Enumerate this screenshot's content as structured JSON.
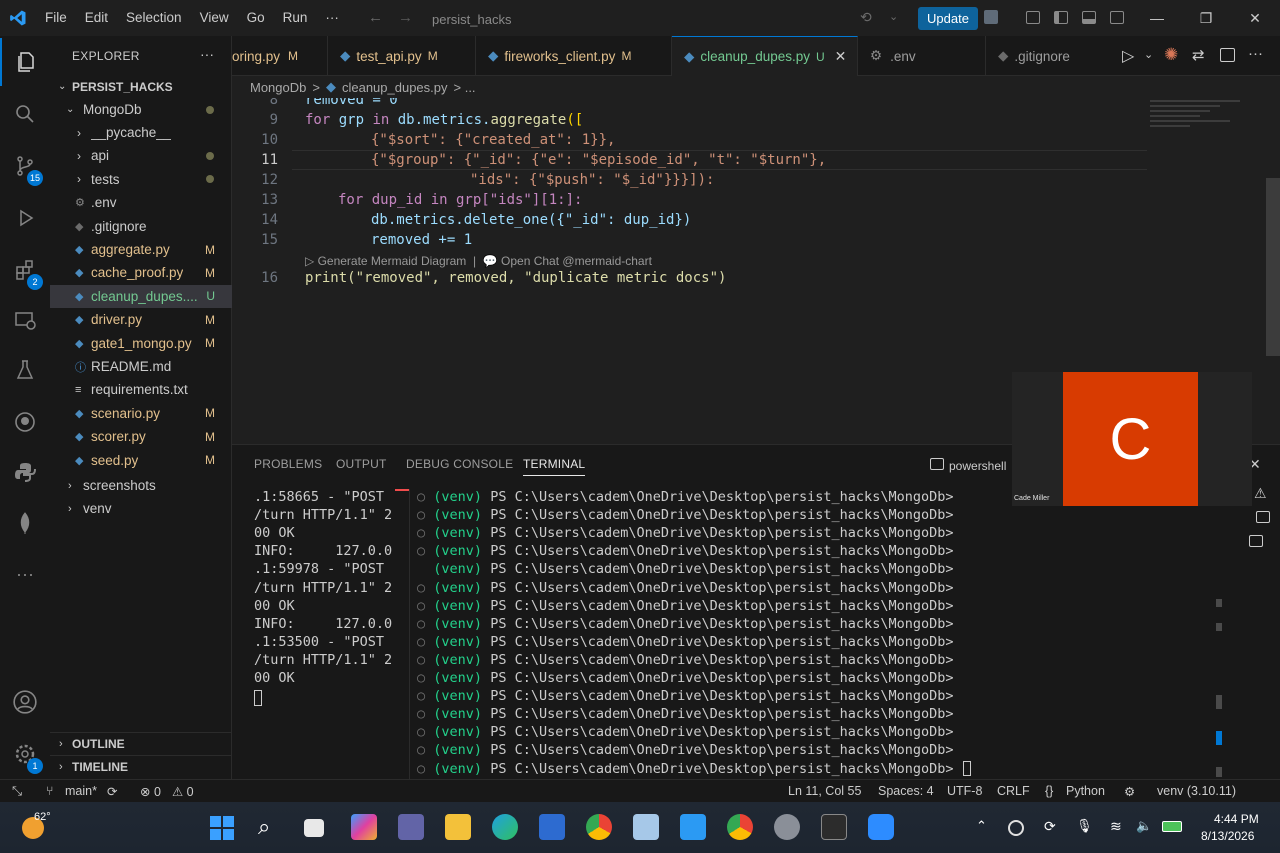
{
  "titlebar": {
    "menu": [
      "File",
      "Edit",
      "Selection",
      "View",
      "Go",
      "Run",
      "···"
    ],
    "search": "persist_hacks",
    "update_label": "Update",
    "icons": [
      "vscode-logo-icon",
      "back-arrow-icon",
      "forward-arrow-icon",
      "copilot-icon",
      "layout-icons",
      "minimize-icon",
      "restore-icon",
      "close-icon"
    ]
  },
  "activitybar": {
    "icons": [
      "explorer-icon",
      "search-icon",
      "source-control-icon",
      "run-debug-icon",
      "extensions-icon",
      "remote-explorer-icon",
      "testing-icon",
      "github-icon",
      "python-icon",
      "mongodb-icon",
      "more-icon",
      "account-icon",
      "manage-icon"
    ],
    "source_control_badge": "15",
    "extensions_badge": "2",
    "manage_badge": "1"
  },
  "sidebar": {
    "title": "EXPLORER",
    "more": "···",
    "root": "PERSIST_HACKS",
    "folder": "MongoDb",
    "items": [
      {
        "label": "__pycache__",
        "kind": "folder",
        "status": ""
      },
      {
        "label": "api",
        "kind": "folder",
        "status": "dot"
      },
      {
        "label": "tests",
        "kind": "folder",
        "status": "dot"
      },
      {
        "label": ".env",
        "kind": "gear",
        "status": ""
      },
      {
        "label": ".gitignore",
        "kind": "git",
        "status": ""
      },
      {
        "label": "aggregate.py",
        "kind": "py",
        "status": "M"
      },
      {
        "label": "cache_proof.py",
        "kind": "py",
        "status": "M"
      },
      {
        "label": "cleanup_dupes....",
        "kind": "py",
        "status": "U"
      },
      {
        "label": "driver.py",
        "kind": "py",
        "status": "M"
      },
      {
        "label": "gate1_mongo.py",
        "kind": "py",
        "status": "M"
      },
      {
        "label": "README.md",
        "kind": "info",
        "status": ""
      },
      {
        "label": "requirements.txt",
        "kind": "txt",
        "status": ""
      },
      {
        "label": "scenario.py",
        "kind": "py",
        "status": "M"
      },
      {
        "label": "scorer.py",
        "kind": "py",
        "status": "M"
      },
      {
        "label": "seed.py",
        "kind": "py",
        "status": "M"
      }
    ],
    "outer": [
      "screenshots",
      "venv"
    ],
    "outline": "OUTLINE",
    "timeline": "TIMELINE"
  },
  "tabs": [
    {
      "label": "oring.py",
      "status": "M"
    },
    {
      "label": "test_api.py",
      "status": "M"
    },
    {
      "label": "fireworks_client.py",
      "status": "M"
    },
    {
      "label": "cleanup_dupes.py",
      "status": "U"
    },
    {
      "label": ".env",
      "status": ""
    },
    {
      "label": ".gitignore",
      "status": ""
    }
  ],
  "breadcrumb": {
    "folder": "MongoDb",
    "sep": ">",
    "file": "cleanup_dupes.py",
    "tail": "> ..."
  },
  "editor": {
    "line_numbers": [
      "8",
      "9",
      "10",
      "11",
      "12",
      "13",
      "14",
      "15",
      "16"
    ],
    "lens": "▷ Generate Mermaid Diagram  |  💬 Open Chat @mermaid-chart",
    "lines": {
      "l8": "removed = 0",
      "l9a": "for",
      "l9b": " grp ",
      "l9c": "in",
      "l9d": " db.metrics.",
      "l9e": "aggregate",
      "l9f": "([",
      "l10": "{\"$sort\": {\"created_at\": 1}},",
      "l11": "{\"$group\": {\"_id\": {\"e\": \"$episode_id\", \"t\": \"$turn\"},",
      "l12": "\"ids\": {\"$push\": \"$_id\"}}}]):",
      "l13": "for dup_id in grp[\"ids\"][1:]:",
      "l14": "db.metrics.delete_one({\"_id\": dup_id})",
      "l15": "removed += 1",
      "l16": "print(\"removed\", removed, \"duplicate metric docs\")"
    }
  },
  "panel": {
    "tabs": [
      "PROBLEMS",
      "OUTPUT",
      "DEBUG CONSOLE",
      "TERMINAL"
    ],
    "shell": "powershell",
    "left_terminal": [
      ".1:58665 - \"POST",
      "/turn HTTP/1.1\" 2",
      "00 OK",
      "INFO:     127.0.0",
      ".1:59978 - \"POST",
      "/turn HTTP/1.1\" 2",
      "00 OK",
      "INFO:     127.0.0",
      ".1:53500 - \"POST",
      "/turn HTTP/1.1\" 2",
      "00 OK"
    ],
    "prompt_venv": "(venv)",
    "prompt_path": "PS C:\\Users\\cadem\\OneDrive\\Desktop\\persist_hacks\\MongoDb>",
    "prompt_count": 16
  },
  "zoom": {
    "initial": "C",
    "name": "Cade Miller"
  },
  "statusbar": {
    "branch": "main*",
    "errors": "⊗ 0",
    "warnings": "⚠ 0",
    "position": "Ln 11, Col 55",
    "spaces": "Spaces: 4",
    "encoding": "UTF-8",
    "eol": "CRLF",
    "language": "Python",
    "interpreter": "venv (3.10.11)"
  },
  "taskbar": {
    "weather": "62°",
    "time": "4:44 PM",
    "date": "8/13/2026"
  },
  "colors": {
    "accent": "#0078d4",
    "modified": "#e2c08d",
    "untracked": "#73c991",
    "zoom_avatar": "#d83b01"
  }
}
